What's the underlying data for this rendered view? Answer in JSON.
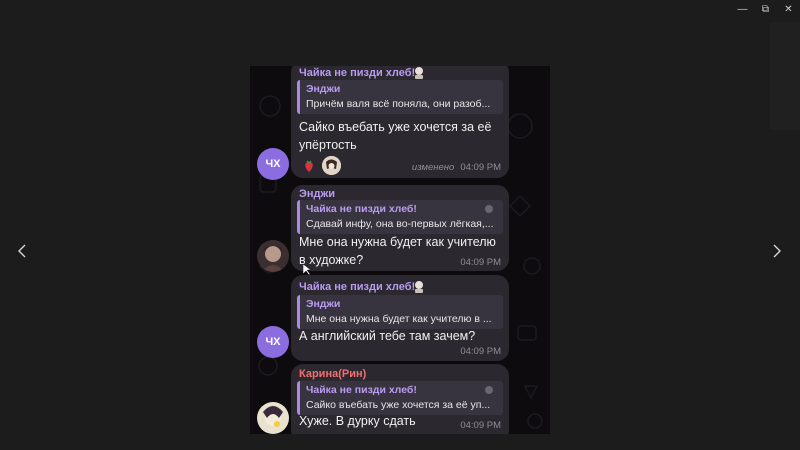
{
  "window": {
    "minimize_label": "—",
    "restore_label": "⧉",
    "close_label": "✕"
  },
  "nav": {
    "prev_icon": "chevron-left-icon",
    "next_icon": "chevron-right-icon"
  },
  "colors": {
    "background": "#1c1c1c",
    "bubble": "#2b2830",
    "accent_purple": "#b99cf0",
    "accent_red": "#f07070",
    "avatar_purple": "#8b6de0"
  },
  "messages": [
    {
      "sender": "Чайка не пизди хлеб!",
      "quote_name": "Энджи",
      "quote_text": "Причём валя всё поняла, они разоб...",
      "text_line1": "Сайко въебать уже хочется за её",
      "text_line2": "упёртость",
      "edited": "изменено",
      "time": "04:09 PM",
      "avatar_initials": "ЧХ"
    },
    {
      "sender": "Энджи",
      "quote_name": "Чайка не пизди хлеб!",
      "quote_text": "Сдавай инфу, она во-первых лёгкая,...",
      "text_line1": "Мне она нужна будет как учителю",
      "text_line2": "в художке?",
      "time": "04:09 PM"
    },
    {
      "sender": "Чайка не пизди хлеб!",
      "quote_name": "Энджи",
      "quote_text": "Мне она нужна будет как учителю в ...",
      "text_line1": "А английский тебе там зачем?",
      "time": "04:09 PM",
      "avatar_initials": "ЧХ"
    },
    {
      "sender": "Карина(Рин)",
      "quote_name": "Чайка не пизди хлеб!",
      "quote_text": "Сайко въебать уже хочется за её уп...",
      "text_line1": "Хуже. В дурку сдать",
      "time": "04:09 PM"
    }
  ]
}
